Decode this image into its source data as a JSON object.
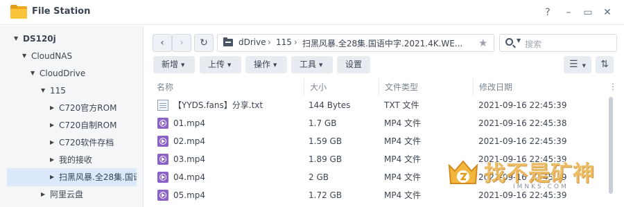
{
  "window": {
    "title": "File Station",
    "help": "?",
    "minimize": "–",
    "maximize": "▭",
    "close": "✕"
  },
  "sidebar": {
    "items": [
      {
        "label": "DS120j",
        "arrow": "▼"
      },
      {
        "label": "CloudNAS",
        "arrow": "▼"
      },
      {
        "label": "CloudDrive",
        "arrow": "▼"
      },
      {
        "label": "115",
        "arrow": "▼"
      },
      {
        "label": "C720官方ROM",
        "arrow": "▶"
      },
      {
        "label": "C720自制ROM",
        "arrow": "▶"
      },
      {
        "label": "C720软件存档",
        "arrow": "▶"
      },
      {
        "label": "我的接收",
        "arrow": "▶"
      },
      {
        "label": "扫黑风暴.全28集.国语",
        "arrow": "▶"
      },
      {
        "label": "阿里云盘",
        "arrow": "▶"
      }
    ]
  },
  "nav": {
    "back": "‹",
    "forward": "›",
    "refresh": "↻"
  },
  "path": {
    "crumbs": [
      "dDrive",
      "115",
      "扫黑风暴.全28集.国语中字.2021.4K.WE..."
    ],
    "separator": "›"
  },
  "search": {
    "placeholder": "搜索"
  },
  "toolbar": {
    "create": "新增",
    "upload": "上传",
    "action": "操作",
    "tools": "工具",
    "settings": "设置"
  },
  "table": {
    "columns": [
      "名称",
      "大小",
      "文件类型",
      "修改日期"
    ],
    "rows": [
      {
        "name": "【YYDS.fans】分享.txt",
        "size": "144 Bytes",
        "type": "TXT 文件",
        "date": "2021-09-16 22:45:39",
        "icon": "txt-file-icon"
      },
      {
        "name": "01.mp4",
        "size": "1.7 GB",
        "type": "MP4 文件",
        "date": "2021-09-16 22:45:38",
        "icon": "video-file-icon"
      },
      {
        "name": "02.mp4",
        "size": "1.59 GB",
        "type": "MP4 文件",
        "date": "2021-09-16 22:45:39",
        "icon": "video-file-icon"
      },
      {
        "name": "03.mp4",
        "size": "1.89 GB",
        "type": "MP4 文件",
        "date": "2021-09-16 22:45:39",
        "icon": "video-file-icon"
      },
      {
        "name": "04.mp4",
        "size": "2 GB",
        "type": "MP4 文件",
        "date": "2021-09-16 22:45:39",
        "icon": "video-file-icon"
      },
      {
        "name": "05.mp4",
        "size": "1.72 GB",
        "type": "MP4 文件",
        "date": "2021-09-16 22:45:39",
        "icon": "video-file-icon"
      }
    ]
  },
  "watermark": {
    "text": "找不是矿神",
    "url": "IMNKS.COM"
  },
  "colors": {
    "selected": "#dbe9fa",
    "mp4_icon": "#8b62c9",
    "folder": "#fbc43a"
  }
}
